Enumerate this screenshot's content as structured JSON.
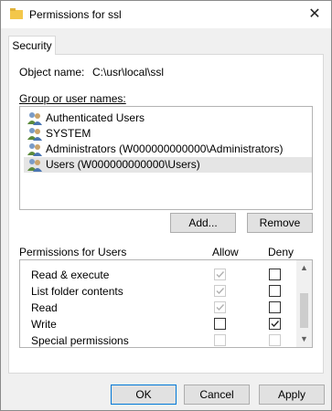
{
  "window": {
    "title": "Permissions for ssl"
  },
  "tab": {
    "label": "Security"
  },
  "object": {
    "label": "Object name:",
    "value": "C:\\usr\\local\\ssl"
  },
  "group": {
    "label": "Group or user names:",
    "items": [
      {
        "label": "Authenticated Users",
        "selected": false
      },
      {
        "label": "SYSTEM",
        "selected": false
      },
      {
        "label": "Administrators (W000000000000\\Administrators)",
        "selected": false
      },
      {
        "label": "Users (W000000000000\\Users)",
        "selected": true
      }
    ]
  },
  "buttons": {
    "add": "Add...",
    "remove": "Remove",
    "ok": "OK",
    "cancel": "Cancel",
    "apply": "Apply"
  },
  "permissions": {
    "title": "Permissions for Users",
    "allow_header": "Allow",
    "deny_header": "Deny",
    "rows": [
      {
        "name": "Read & execute",
        "allow": true,
        "allow_disabled": true,
        "deny": false,
        "deny_disabled": false
      },
      {
        "name": "List folder contents",
        "allow": true,
        "allow_disabled": true,
        "deny": false,
        "deny_disabled": false
      },
      {
        "name": "Read",
        "allow": true,
        "allow_disabled": true,
        "deny": false,
        "deny_disabled": false
      },
      {
        "name": "Write",
        "allow": false,
        "allow_disabled": false,
        "deny": true,
        "deny_disabled": false
      },
      {
        "name": "Special permissions",
        "allow": false,
        "allow_disabled": true,
        "deny": false,
        "deny_disabled": true
      }
    ]
  }
}
